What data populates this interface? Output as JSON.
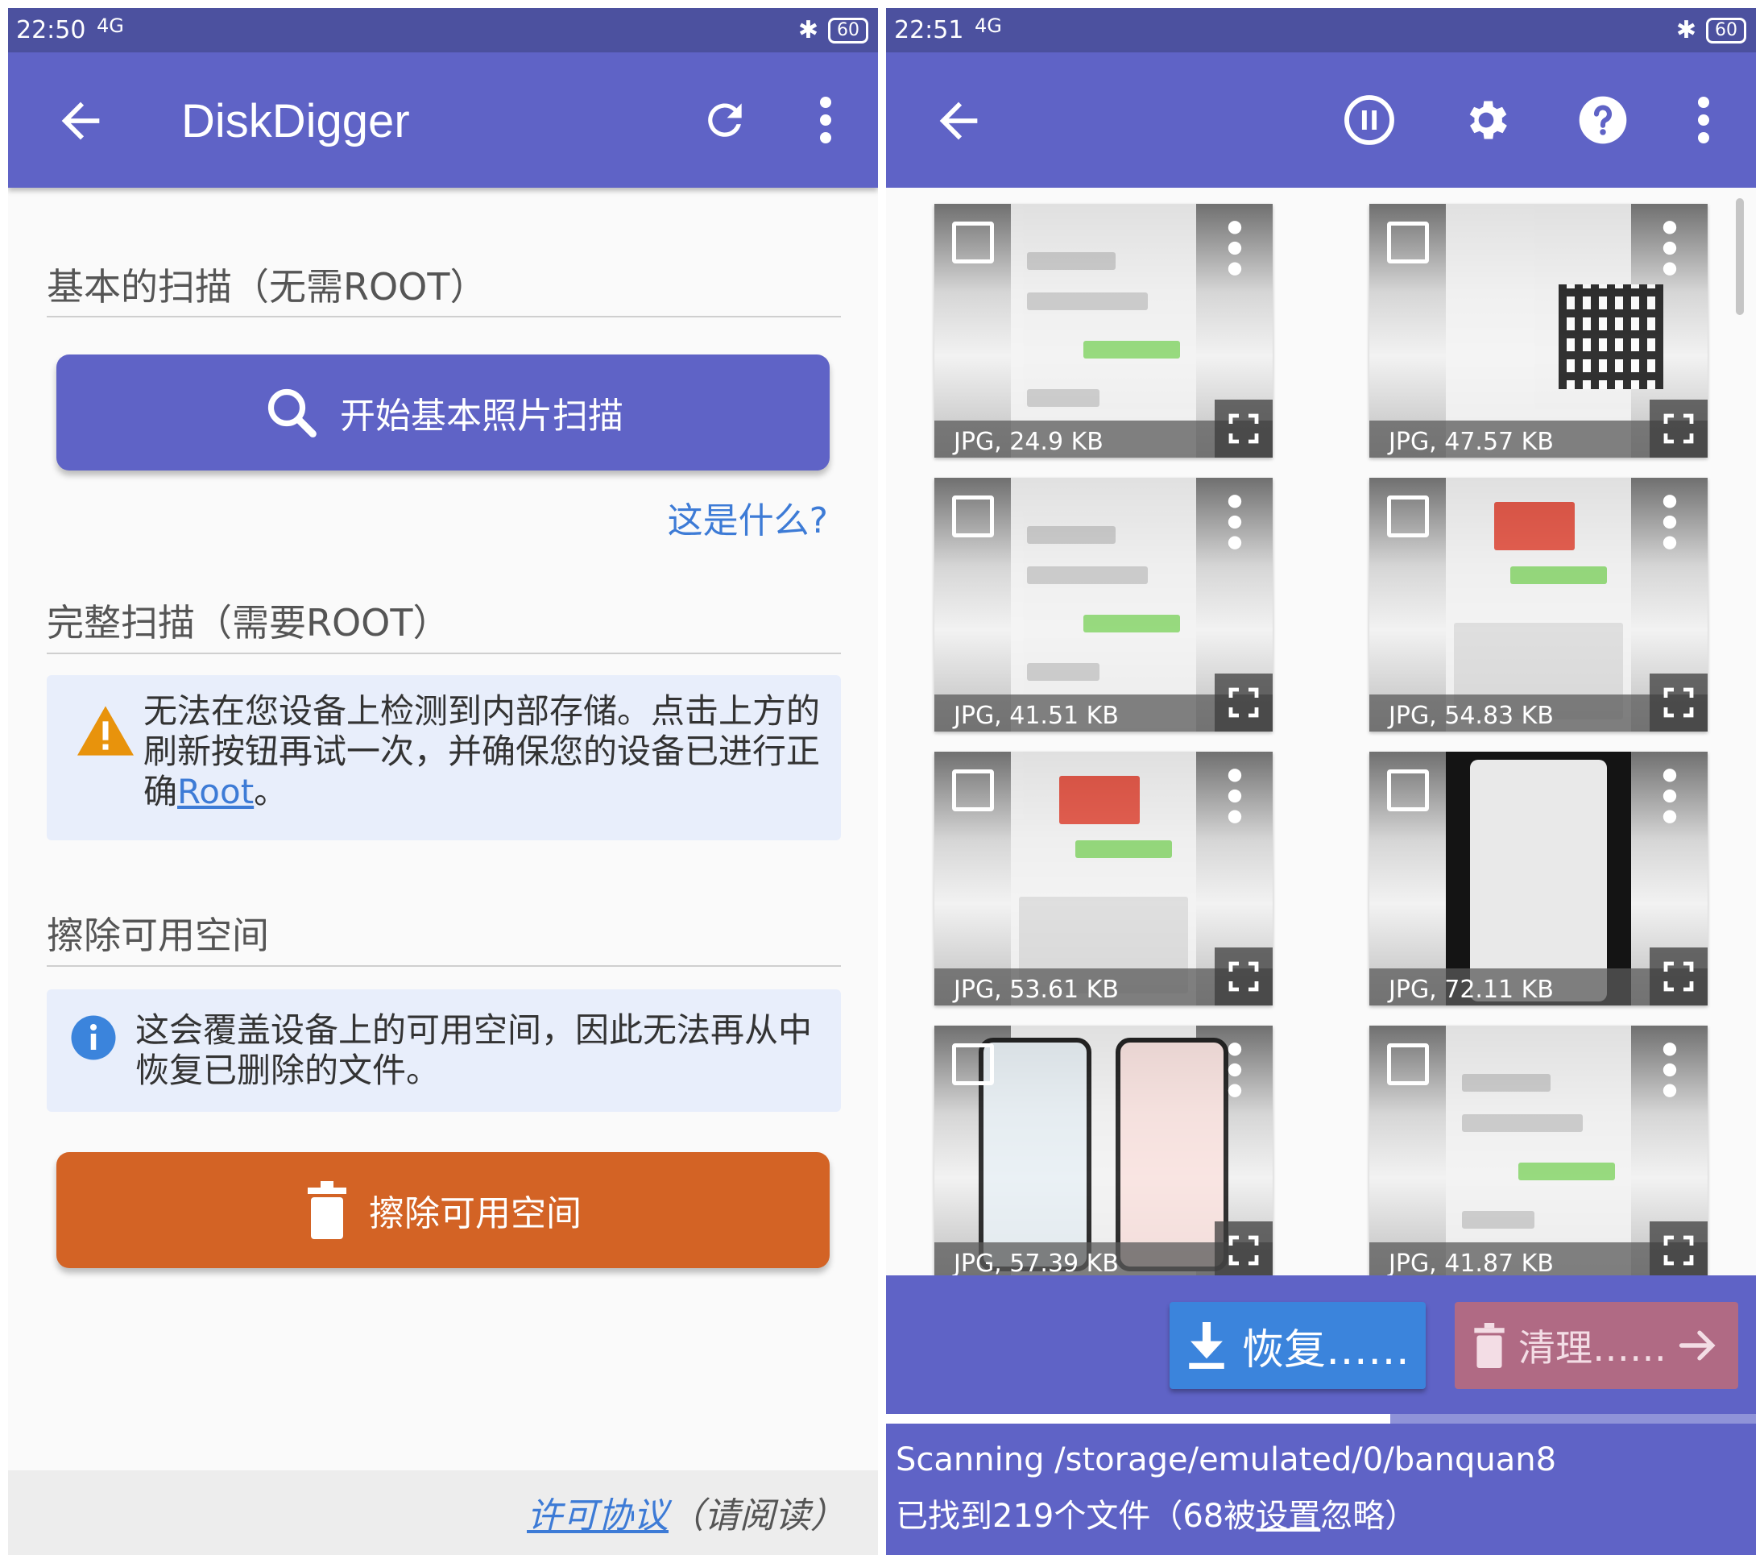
{
  "left": {
    "status": {
      "time": "22:50",
      "network": "4G",
      "battery": "60"
    },
    "appbar": {
      "title": "DiskDigger"
    },
    "basic_scan": {
      "title": "基本的扫描（无需ROOT）",
      "button_label": "开始基本照片扫描",
      "help_link": "这是什么?"
    },
    "full_scan": {
      "title": "完整扫描（需要ROOT）",
      "warning_text": "无法在您设备上检测到内部存储。点击上方的刷新按钮再试一次，并确保您的设备已进行正确",
      "warning_link": "Root",
      "warning_end": "。"
    },
    "wipe": {
      "title": "擦除可用空间",
      "info_text": "这会覆盖设备上的可用空间，因此无法再从中恢复已删除的文件。",
      "button_label": "擦除可用空间"
    },
    "footer": {
      "license_link": "许可协议",
      "license_suffix": "（请阅读）"
    }
  },
  "right": {
    "status": {
      "time": "22:51",
      "network": "4G",
      "battery": "60"
    },
    "files": [
      {
        "caption": "JPG, 24.9 KB",
        "kind": "chat"
      },
      {
        "caption": "JPG, 47.57 KB",
        "kind": "qr"
      },
      {
        "caption": "JPG, 41.51 KB",
        "kind": "chat"
      },
      {
        "caption": "JPG, 54.83 KB",
        "kind": "keyboard"
      },
      {
        "caption": "JPG, 53.61 KB",
        "kind": "keyboard"
      },
      {
        "caption": "JPG, 72.11 KB",
        "kind": "photo"
      },
      {
        "caption": "JPG, 57.39 KB",
        "kind": "phones"
      },
      {
        "caption": "JPG, 41.87 KB",
        "kind": "chat"
      }
    ],
    "actions": {
      "restore_label": "恢复……",
      "clean_label": "清理……"
    },
    "scan_progress": 0.58,
    "scan_status": {
      "path_line": "Scanning /storage/emulated/0/banquan8",
      "found_prefix": "已找到219个文件（68被",
      "settings_link": "设置",
      "found_suffix": "忽略）"
    }
  },
  "colors": {
    "status_bar": "#4c519f",
    "app_bar": "#5f63c6",
    "danger": "#d36325",
    "restore": "#3b84dc",
    "clean_disabled": "#b06a84",
    "link": "#3d7bd6"
  },
  "icons": [
    "back-arrow-icon",
    "refresh-icon",
    "overflow-menu-icon",
    "search-icon",
    "warning-icon",
    "info-icon",
    "trash-icon",
    "pause-icon",
    "settings-gear-icon",
    "help-icon",
    "checkbox-icon",
    "expand-icon",
    "download-icon",
    "arrow-right-icon"
  ]
}
